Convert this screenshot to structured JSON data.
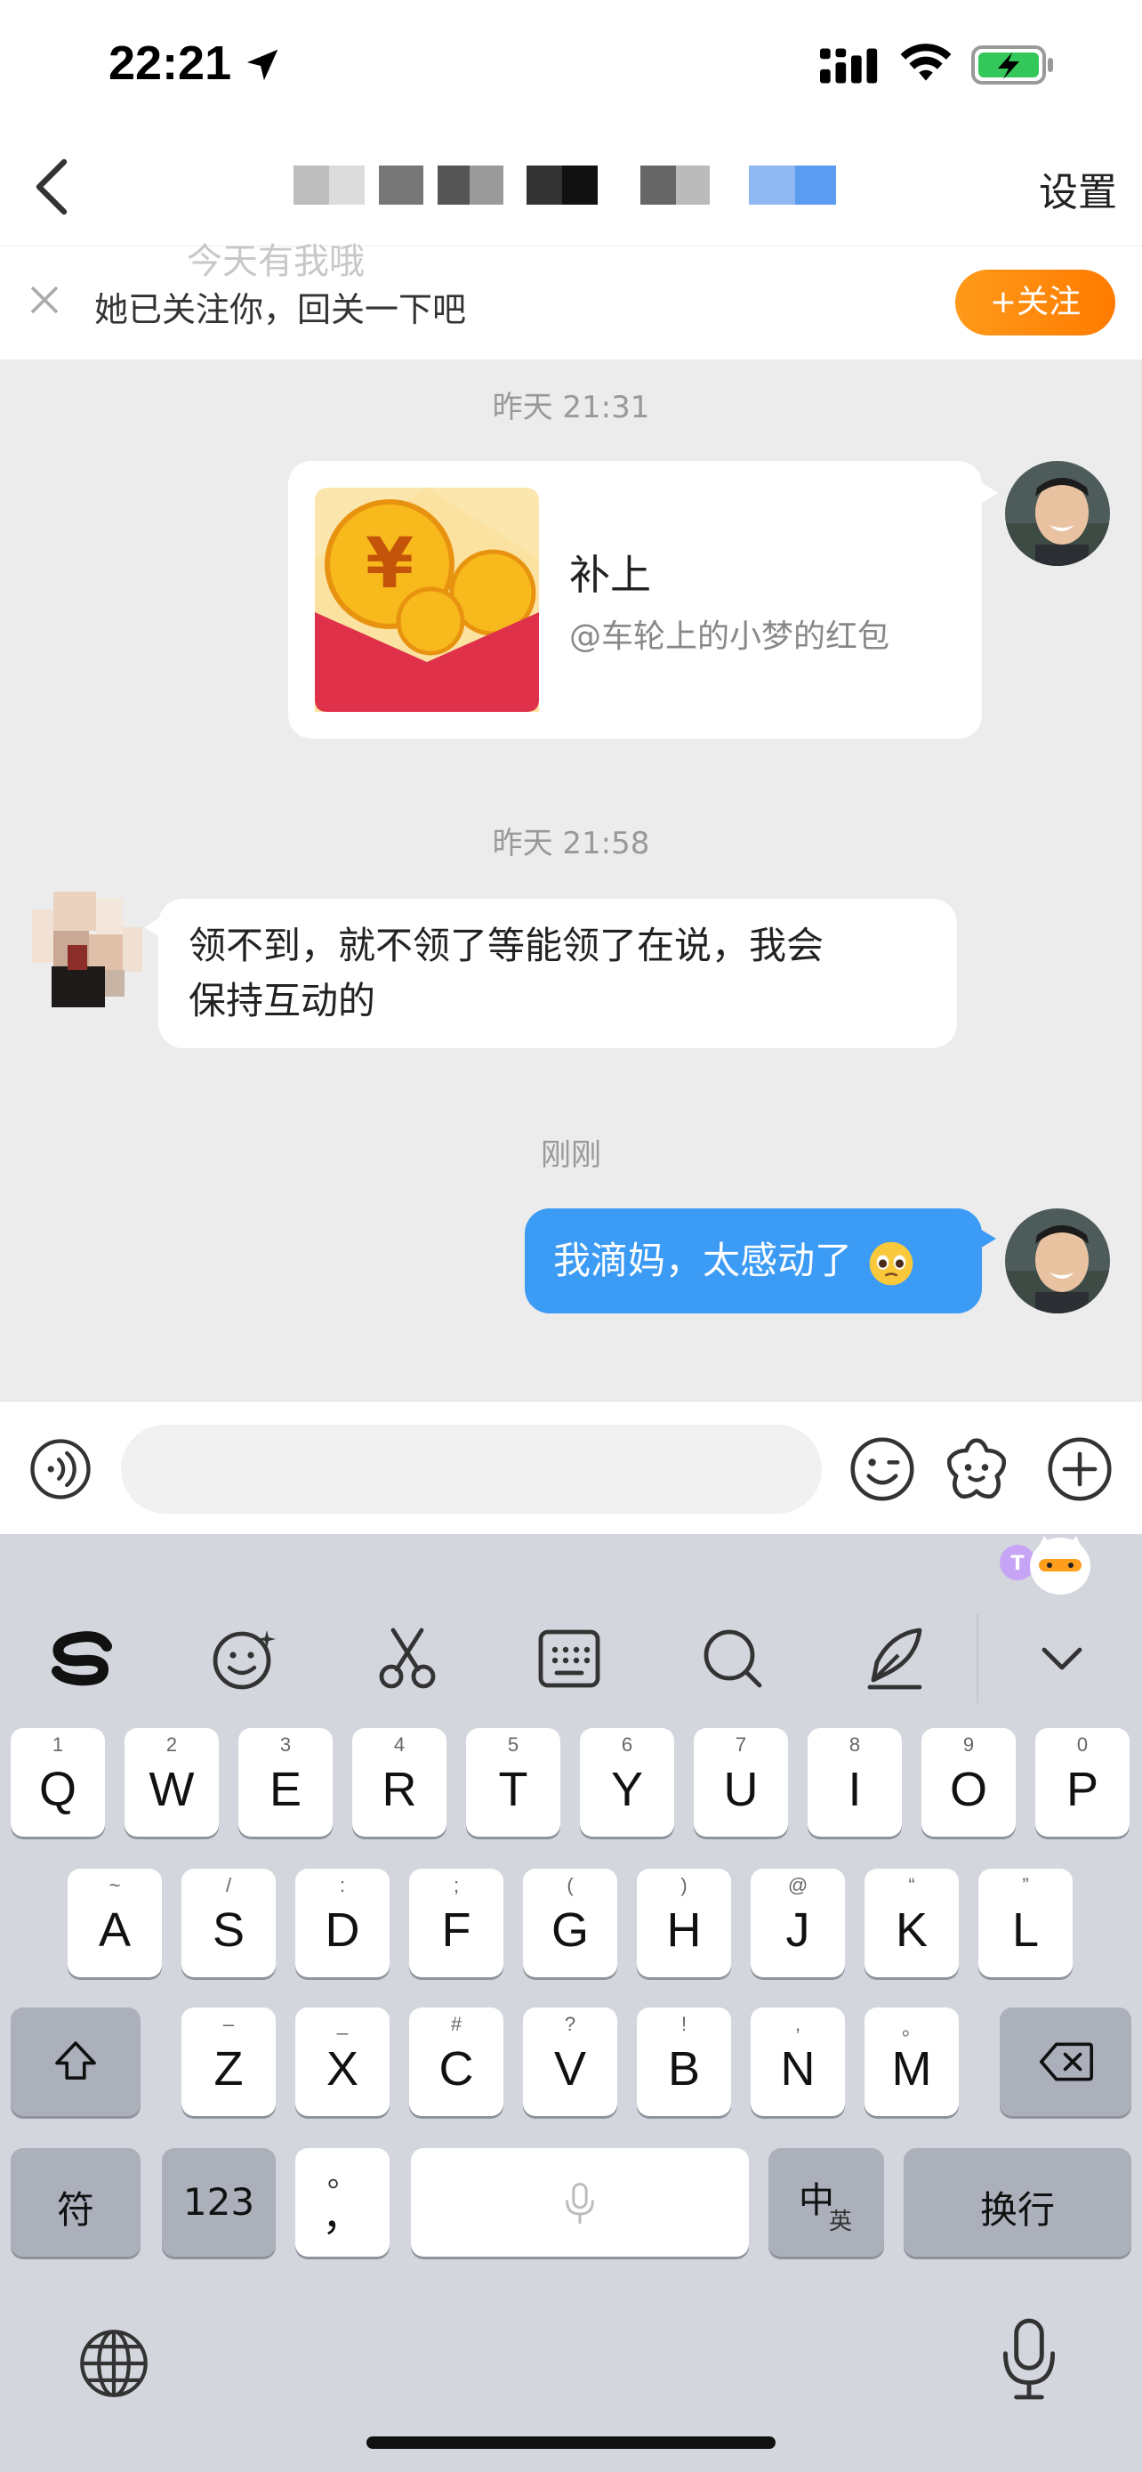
{
  "status": {
    "time": "22:21"
  },
  "nav": {
    "back_icon": "chevron-left-icon",
    "settings_label": "设置"
  },
  "banner": {
    "faded_text": "今天有我哦",
    "text": "她已关注你，回关一下吧",
    "follow_label": "+关注"
  },
  "chat": {
    "timestamps": [
      "昨天 21:31",
      "昨天 21:58",
      "刚刚"
    ],
    "red_packet": {
      "title": "补上",
      "subtitle": "@车轮上的小梦的红包"
    },
    "incoming_message": {
      "line1": "领不到，就不领了等能领了在说，我会",
      "line2": "保持互动的"
    },
    "outgoing_message": {
      "text": "我滴妈，太感动了",
      "emoji": "pleading-face-emoji"
    }
  },
  "input": {
    "placeholder": ""
  },
  "keyboard": {
    "toolbar": [
      "sogou-logo-icon",
      "emoji-icon",
      "scissors-icon",
      "keyboard-icon",
      "search-icon",
      "pen-icon",
      "chevron-down-icon"
    ],
    "row1": [
      {
        "key": "Q",
        "sub": "1"
      },
      {
        "key": "W",
        "sub": "2"
      },
      {
        "key": "E",
        "sub": "3"
      },
      {
        "key": "R",
        "sub": "4"
      },
      {
        "key": "T",
        "sub": "5"
      },
      {
        "key": "Y",
        "sub": "6"
      },
      {
        "key": "U",
        "sub": "7"
      },
      {
        "key": "I",
        "sub": "8"
      },
      {
        "key": "O",
        "sub": "9"
      },
      {
        "key": "P",
        "sub": "0"
      }
    ],
    "row2": [
      {
        "key": "A",
        "sub": "~"
      },
      {
        "key": "S",
        "sub": "/"
      },
      {
        "key": "D",
        "sub": ":"
      },
      {
        "key": "F",
        "sub": ";"
      },
      {
        "key": "G",
        "sub": "("
      },
      {
        "key": "H",
        "sub": ")"
      },
      {
        "key": "J",
        "sub": "@"
      },
      {
        "key": "K",
        "sub": "“"
      },
      {
        "key": "L",
        "sub": "”"
      }
    ],
    "row3": [
      {
        "key": "Z",
        "sub": "–"
      },
      {
        "key": "X",
        "sub": "_"
      },
      {
        "key": "C",
        "sub": "#"
      },
      {
        "key": "V",
        "sub": "?"
      },
      {
        "key": "B",
        "sub": "!"
      },
      {
        "key": "N",
        "sub": ","
      },
      {
        "key": "M",
        "sub": "。"
      }
    ],
    "symbol_label": "符",
    "num_label": "123",
    "punct_main": "，",
    "punct_sub": "。",
    "lang_main": "中",
    "lang_sub": "英",
    "return_label": "换行"
  },
  "colors": {
    "bubble_out": "#3c9bf5",
    "follow_btn": "#ff8a00",
    "keyboard_bg": "#d3d6dd"
  }
}
